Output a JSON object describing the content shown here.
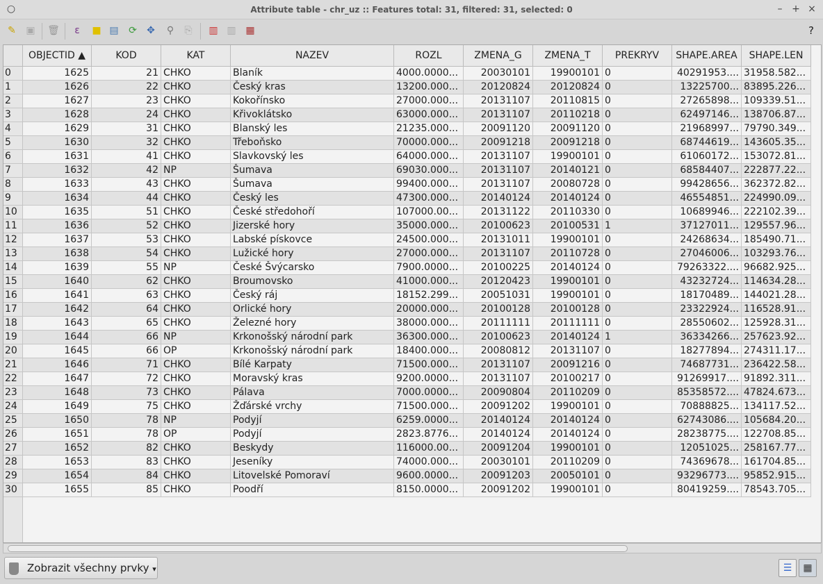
{
  "window": {
    "title": "Attribute table - chr_uz :: Features total: 31, filtered: 31, selected: 0",
    "minimize": "–",
    "maximize": "+",
    "close": "×"
  },
  "toolbar": {
    "help": "?",
    "icons": [
      "pencil-icon",
      "save-icon",
      "delete-icon",
      "expression-select-icon",
      "deselect-icon",
      "move-selection-top-icon",
      "invert-selection-icon",
      "pan-to-selection-icon",
      "zoom-to-selection-icon",
      "copy-icon",
      "delete-column-icon",
      "add-column-icon",
      "field-calculator-icon"
    ]
  },
  "table": {
    "columns": [
      "OBJECTID ▲",
      "KOD",
      "KAT",
      "NAZEV",
      "ROZL",
      "ZMENA_G",
      "ZMENA_T",
      "PREKRYV",
      "SHAPE.AREA",
      "SHAPE.LEN"
    ],
    "rows": [
      [
        "0",
        "1625",
        "21",
        "CHKO",
        "Blaník",
        "4000.0000...",
        "20030101",
        "19900101",
        "0",
        "40291953....",
        "31958.582..."
      ],
      [
        "1",
        "1626",
        "22",
        "CHKO",
        "Český kras",
        "13200.000...",
        "20120824",
        "20120824",
        "0",
        "13225700...",
        "83895.226..."
      ],
      [
        "2",
        "1627",
        "23",
        "CHKO",
        "Kokořínsko",
        "27000.000...",
        "20131107",
        "20110815",
        "0",
        "27265898...",
        "109339.51..."
      ],
      [
        "3",
        "1628",
        "24",
        "CHKO",
        "Křivoklátsko",
        "63000.000...",
        "20131107",
        "20110218",
        "0",
        "62497146...",
        "138706.87..."
      ],
      [
        "4",
        "1629",
        "31",
        "CHKO",
        "Blanský les",
        "21235.000...",
        "20091120",
        "20091120",
        "0",
        "21968997...",
        "79790.349..."
      ],
      [
        "5",
        "1630",
        "32",
        "CHKO",
        "Třeboňsko",
        "70000.000...",
        "20091218",
        "20091218",
        "0",
        "68744619...",
        "143605.35..."
      ],
      [
        "6",
        "1631",
        "41",
        "CHKO",
        "Slavkovský les",
        "64000.000...",
        "20131107",
        "19900101",
        "0",
        "61060172...",
        "153072.81..."
      ],
      [
        "7",
        "1632",
        "42",
        "NP",
        "Šumava",
        "69030.000...",
        "20131107",
        "20140121",
        "0",
        "68584407...",
        "222877.22..."
      ],
      [
        "8",
        "1633",
        "43",
        "CHKO",
        "Šumava",
        "99400.000...",
        "20131107",
        "20080728",
        "0",
        "99428656...",
        "362372.82..."
      ],
      [
        "9",
        "1634",
        "44",
        "CHKO",
        "Český les",
        "47300.000...",
        "20140124",
        "20140124",
        "0",
        "46554851...",
        "224990.09..."
      ],
      [
        "10",
        "1635",
        "51",
        "CHKO",
        "České středohoří",
        "107000.00...",
        "20131122",
        "20110330",
        "0",
        "10689946...",
        "222102.39..."
      ],
      [
        "11",
        "1636",
        "52",
        "CHKO",
        "Jizerské hory",
        "35000.000...",
        "20100623",
        "20100531",
        "1",
        "37127011...",
        "129557.96..."
      ],
      [
        "12",
        "1637",
        "53",
        "CHKO",
        "Labské pískovce",
        "24500.000...",
        "20131011",
        "19900101",
        "0",
        "24268634...",
        "185490.71..."
      ],
      [
        "13",
        "1638",
        "54",
        "CHKO",
        "Lužické hory",
        "27000.000...",
        "20131107",
        "20110728",
        "0",
        "27046006...",
        "103293.76..."
      ],
      [
        "14",
        "1639",
        "55",
        "NP",
        "České Švýcarsko",
        "7900.0000...",
        "20100225",
        "20140124",
        "0",
        "79263322....",
        "96682.925..."
      ],
      [
        "15",
        "1640",
        "62",
        "CHKO",
        "Broumovsko",
        "41000.000...",
        "20120423",
        "19900101",
        "0",
        "43232724...",
        "114634.28..."
      ],
      [
        "16",
        "1641",
        "63",
        "CHKO",
        "Český ráj",
        "18152.299...",
        "20051031",
        "19900101",
        "0",
        "18170489...",
        "144021.28..."
      ],
      [
        "17",
        "1642",
        "64",
        "CHKO",
        "Orlické hory",
        "20000.000...",
        "20100128",
        "20100128",
        "0",
        "23322924...",
        "116528.91..."
      ],
      [
        "18",
        "1643",
        "65",
        "CHKO",
        "Železné hory",
        "38000.000...",
        "20111111",
        "20111111",
        "0",
        "28550602...",
        "125928.31..."
      ],
      [
        "19",
        "1644",
        "66",
        "NP",
        "Krkonošský národní park",
        "36300.000...",
        "20100623",
        "20140124",
        "1",
        "36334266...",
        "257623.92..."
      ],
      [
        "20",
        "1645",
        "66",
        "OP",
        "Krkonošský národní park",
        "18400.000...",
        "20080812",
        "20131107",
        "0",
        "18277894...",
        "274311.17..."
      ],
      [
        "21",
        "1646",
        "71",
        "CHKO",
        "Bílé Karpaty",
        "71500.000...",
        "20131107",
        "20091216",
        "0",
        "74687731...",
        "236422.58..."
      ],
      [
        "22",
        "1647",
        "72",
        "CHKO",
        "Moravský kras",
        "9200.0000...",
        "20131107",
        "20100217",
        "0",
        "91269917....",
        "91892.311..."
      ],
      [
        "23",
        "1648",
        "73",
        "CHKO",
        "Pálava",
        "7000.0000...",
        "20090804",
        "20110209",
        "0",
        "85358572....",
        "47824.673..."
      ],
      [
        "24",
        "1649",
        "75",
        "CHKO",
        "Žďárské vrchy",
        "71500.000...",
        "20091202",
        "19900101",
        "0",
        "70888825...",
        "134117.52..."
      ],
      [
        "25",
        "1650",
        "78",
        "NP",
        "Podyjí",
        "6259.0000...",
        "20140124",
        "20140124",
        "0",
        "62743086....",
        "105684.20..."
      ],
      [
        "26",
        "1651",
        "78",
        "OP",
        "Podyjí",
        "2823.8776...",
        "20140124",
        "20140124",
        "0",
        "28238775....",
        "122708.85..."
      ],
      [
        "27",
        "1652",
        "82",
        "CHKO",
        "Beskydy",
        "116000.00...",
        "20091204",
        "19900101",
        "0",
        "12051025...",
        "258167.77..."
      ],
      [
        "28",
        "1653",
        "83",
        "CHKO",
        "Jeseníky",
        "74000.000...",
        "20030101",
        "20110209",
        "0",
        "74369678...",
        "161704.85..."
      ],
      [
        "29",
        "1654",
        "84",
        "CHKO",
        "Litovelské Pomoraví",
        "9600.0000...",
        "20091203",
        "20050101",
        "0",
        "93296773....",
        "95852.915..."
      ],
      [
        "30",
        "1655",
        "85",
        "CHKO",
        "Poodří",
        "8150.0000...",
        "20091202",
        "19900101",
        "0",
        "80419259....",
        "78543.705..."
      ]
    ]
  },
  "footer": {
    "filter_label": "Zobrazit všechny prvky",
    "filter_arrow": "▾",
    "form_view": "☰",
    "table_view": "▦"
  }
}
